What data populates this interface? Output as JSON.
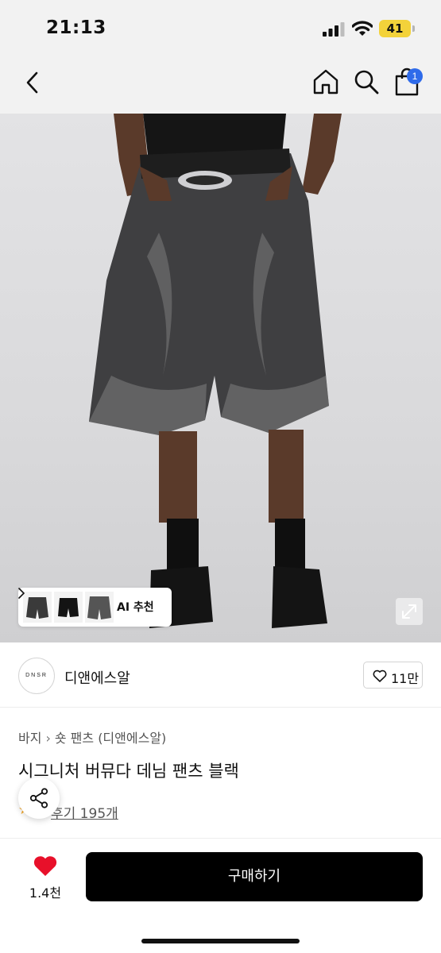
{
  "status_bar": {
    "time": "21:13",
    "battery": "41"
  },
  "nav": {
    "cart_count": "1"
  },
  "hero": {
    "ai_recommend_label": "AI 추천"
  },
  "brand": {
    "logo_text": "DNSR",
    "name": "디앤에스알",
    "likes": "11만"
  },
  "product": {
    "breadcrumb": [
      "바지",
      "숏 팬츠 (디앤에스알)"
    ],
    "title": "시그니처 버뮤다 데님 팬츠 블랙",
    "review_text": "후기 195개"
  },
  "bottom_bar": {
    "wish_count": "1.4천",
    "buy_label": "구매하기"
  },
  "colors": {
    "accent_badge": "#2f6bea",
    "battery": "#f3d23a",
    "heart": "#e8102a",
    "buy_button": "#000000",
    "star": "#f5a623"
  }
}
